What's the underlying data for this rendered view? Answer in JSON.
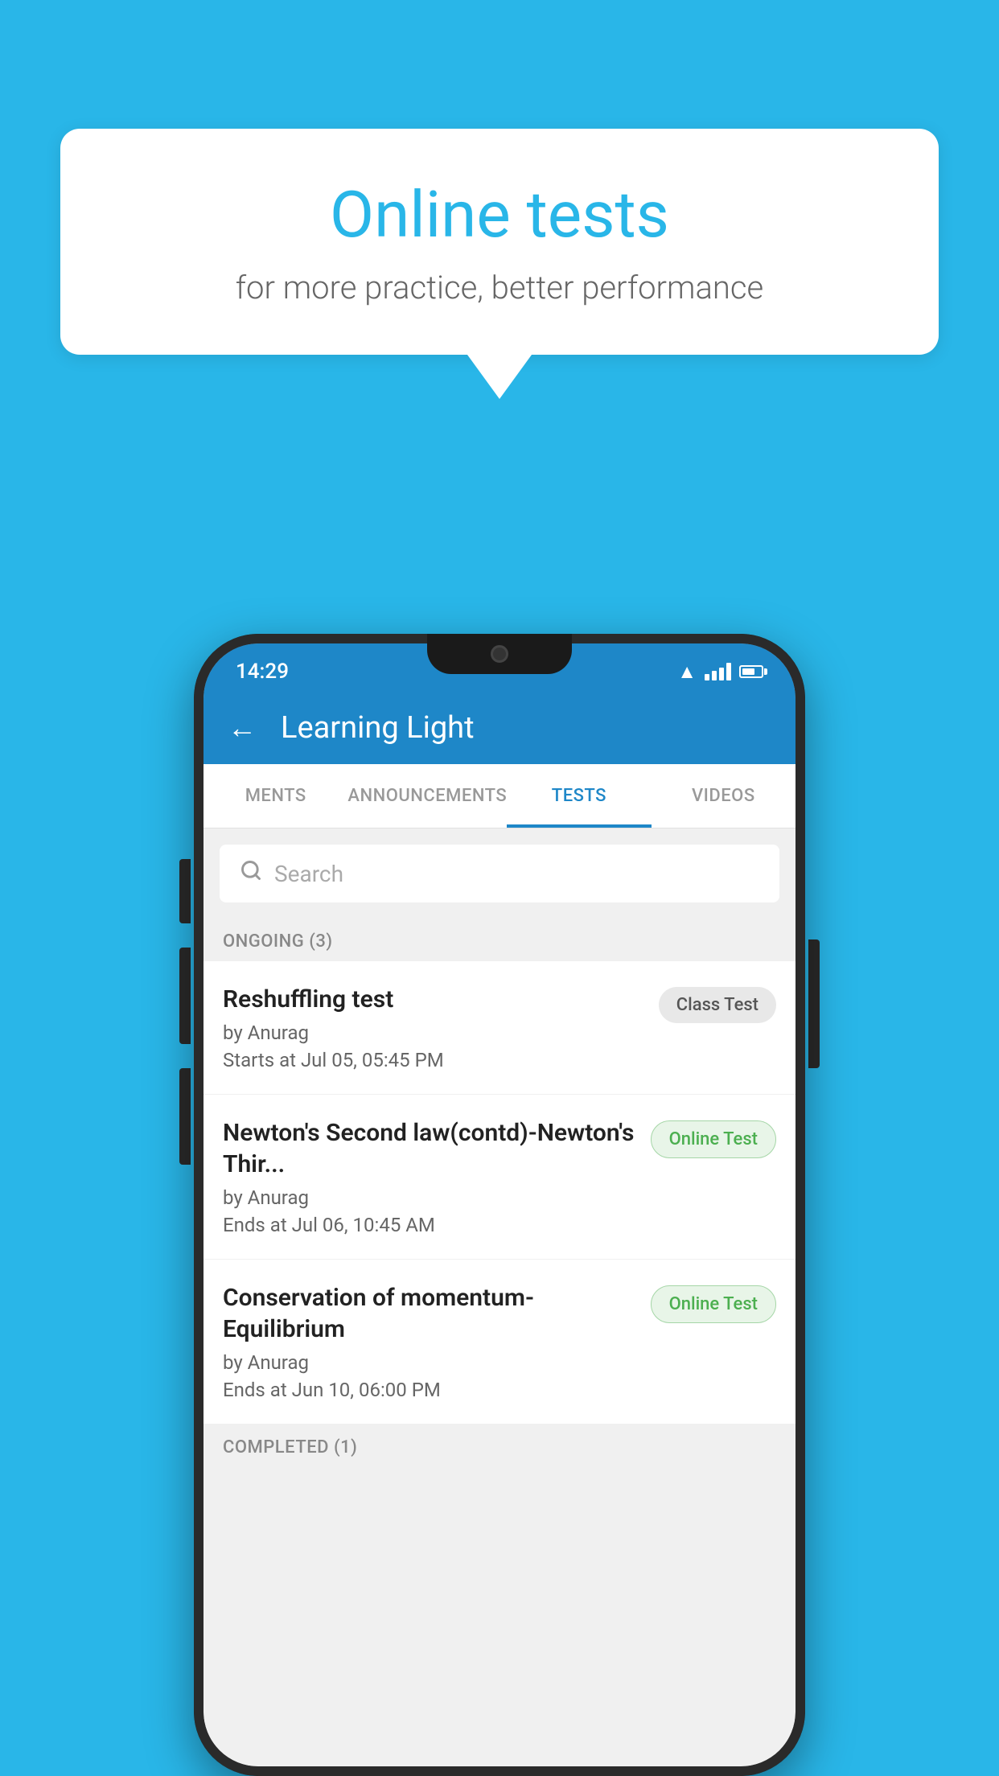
{
  "background_color": "#29b6e8",
  "speech_bubble": {
    "title": "Online tests",
    "subtitle": "for more practice, better performance"
  },
  "phone": {
    "status_bar": {
      "time": "14:29"
    },
    "app_header": {
      "title": "Learning Light",
      "back_label": "←"
    },
    "tabs": [
      {
        "label": "MENTS",
        "active": false
      },
      {
        "label": "ANNOUNCEMENTS",
        "active": false
      },
      {
        "label": "TESTS",
        "active": true
      },
      {
        "label": "VIDEOS",
        "active": false
      }
    ],
    "search": {
      "placeholder": "Search"
    },
    "ongoing_section": {
      "header": "ONGOING (3)",
      "tests": [
        {
          "name": "Reshuffling test",
          "author": "by Anurag",
          "time_label": "Starts at",
          "time": "Jul 05, 05:45 PM",
          "badge": "Class Test",
          "badge_type": "class"
        },
        {
          "name": "Newton's Second law(contd)-Newton's Thir...",
          "author": "by Anurag",
          "time_label": "Ends at",
          "time": "Jul 06, 10:45 AM",
          "badge": "Online Test",
          "badge_type": "online"
        },
        {
          "name": "Conservation of momentum-Equilibrium",
          "author": "by Anurag",
          "time_label": "Ends at",
          "time": "Jun 10, 06:00 PM",
          "badge": "Online Test",
          "badge_type": "online"
        }
      ]
    },
    "completed_section": {
      "header": "COMPLETED (1)"
    }
  }
}
